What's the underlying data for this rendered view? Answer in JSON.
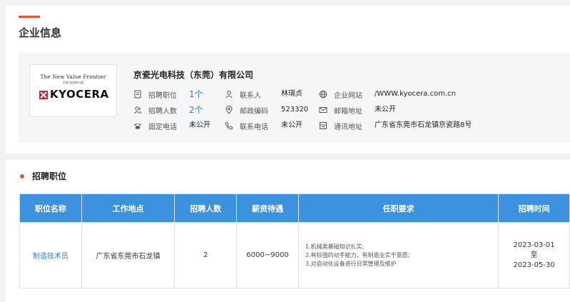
{
  "company_section": {
    "title": "企业信息",
    "company_name": "京瓷光电科技（东莞）有限公司",
    "logo": {
      "tagline": "The New Value Frontier",
      "subtext": "京瓷 创造新价值",
      "brand": "KYOCERA"
    },
    "fields": {
      "positions": {
        "label": "招聘职位",
        "value": "1个"
      },
      "headcount": {
        "label": "招聘人数",
        "value": "2个"
      },
      "phone": {
        "label": "固定电话",
        "value": "未公开"
      },
      "contact": {
        "label": "联系人",
        "value": "林瑞贞"
      },
      "postcode": {
        "label": "邮政编码",
        "value": "523320"
      },
      "mobile": {
        "label": "联系电话",
        "value": "未公开"
      },
      "website": {
        "label": "企业网站",
        "value": "/WWW.kyocera.com.cn"
      },
      "email": {
        "label": "邮箱地址",
        "value": "未公开"
      },
      "address": {
        "label": "通讯地址",
        "value": "广东省东莞市石龙镇京瓷路8号"
      }
    }
  },
  "jobs_section": {
    "title": "招聘职位",
    "headers": [
      "职位名称",
      "工作地点",
      "招聘人数",
      "薪资待遇",
      "任职要求",
      "招聘时间"
    ],
    "rows": [
      {
        "job_name": "制造技术员",
        "location": "广东省东莞市石龙镇",
        "count": "2",
        "salary": "6000~9000",
        "requirements": [
          "1.机械类基础知识扎实;",
          "2.有较强的动手能力，有制造业实干意愿;",
          "3.对自动化设备进行日常管理及维护"
        ],
        "time_start": "2023-03-01",
        "time_sep": "至",
        "time_end": "2023-05-30"
      }
    ]
  },
  "colors": {
    "accent": "#e9533e",
    "header_blue": "#3d92df",
    "link_blue": "#2a7bd9"
  }
}
